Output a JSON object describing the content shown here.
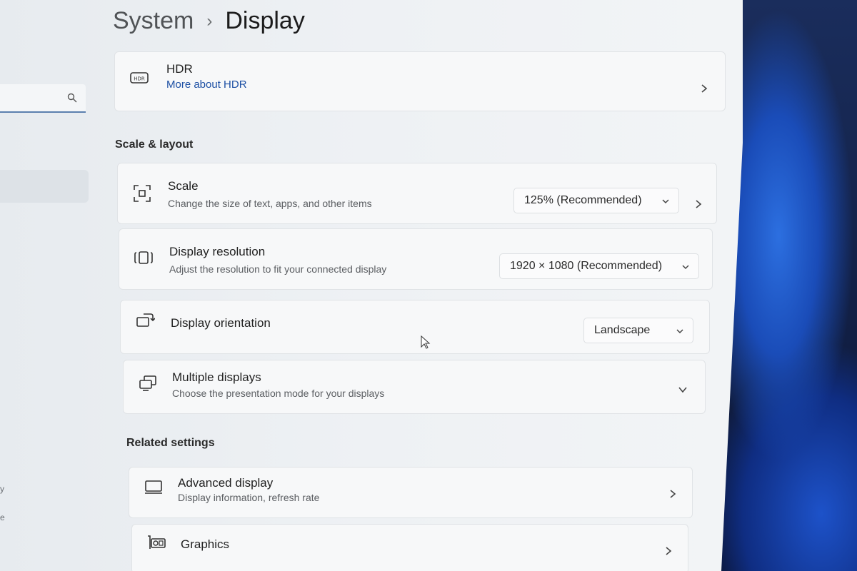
{
  "breadcrumb": {
    "parent": "System",
    "separator": "›",
    "current": "Display"
  },
  "sidebar": {
    "frag_1": "y",
    "frag_2": "e"
  },
  "hdr": {
    "title": "HDR",
    "link": "More about HDR"
  },
  "sections": {
    "scale_layout": "Scale & layout",
    "related": "Related settings"
  },
  "scale": {
    "title": "Scale",
    "subtitle": "Change the size of text, apps, and other items",
    "value": "125% (Recommended)"
  },
  "resolution": {
    "title": "Display resolution",
    "subtitle": "Adjust the resolution to fit your connected display",
    "value": "1920 × 1080 (Recommended)"
  },
  "orientation": {
    "title": "Display orientation",
    "value": "Landscape"
  },
  "multiple": {
    "title": "Multiple displays",
    "subtitle": "Choose the presentation mode for your displays"
  },
  "advanced": {
    "title": "Advanced display",
    "subtitle": "Display information, refresh rate"
  },
  "graphics": {
    "title": "Graphics"
  },
  "icons": {
    "hdr": "hdr-icon",
    "scale": "scale-icon",
    "resolution": "resolution-icon",
    "orientation": "orientation-icon",
    "multiple": "multiple-displays-icon",
    "advanced": "monitor-icon",
    "graphics": "graphics-card-icon",
    "search": "search-icon",
    "chevron_right": "chevron-right-icon",
    "chevron_down": "chevron-down-icon"
  },
  "colors": {
    "accent_link": "#1b4ea3",
    "search_underline": "#5b7fae"
  }
}
